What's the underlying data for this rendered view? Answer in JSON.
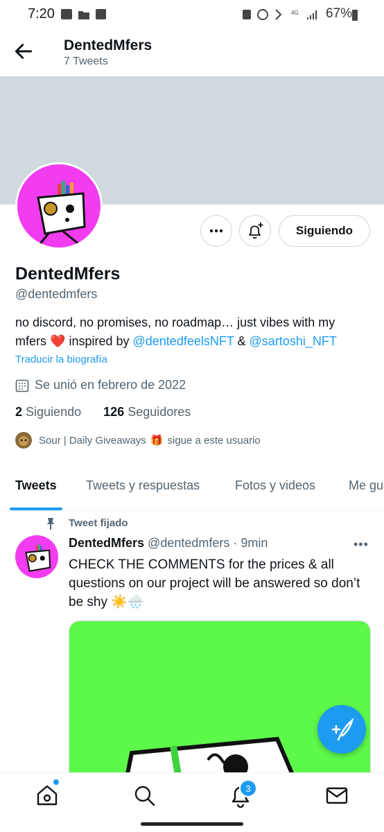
{
  "status_bar": {
    "time": "7:20",
    "battery": "67%"
  },
  "header": {
    "title": "DentedMfers",
    "subtitle": "7 Tweets"
  },
  "profile": {
    "name": "DentedMfers",
    "handle": "@dentedmfers",
    "follow_button": "Siguiendo",
    "bio_text_1": "no discord, no promises, no roadmap… just vibes with my mfers ",
    "bio_text_2": " inspired by ",
    "bio_link_1": "@dentedfeelsNFT",
    "bio_text_3": " & ",
    "bio_link_2": "@sartoshi_NFT",
    "translate": "Traducir la biografía",
    "joined": "Se unió en febrero de 2022",
    "following_count": "2",
    "following_label": "Siguiendo",
    "followers_count": "126",
    "followers_label": "Seguidores",
    "followed_by_text": "Sour | Daily Giveaways",
    "followed_by_suffix": "sigue a este usuario"
  },
  "tabs": [
    "Tweets",
    "Tweets y respuestas",
    "Fotos y videos",
    "Me gusta"
  ],
  "tweet": {
    "pinned_label": "Tweet fijado",
    "name": "DentedMfers",
    "handle": "@dentedmfers",
    "time": "· 9min",
    "text": "CHECK THE COMMENTS for the prices & all questions on our project will be answered so don’t be shy ☀️🌧️"
  },
  "bottom_nav": {
    "notifications_badge": "3"
  },
  "icons": [
    "back-arrow-icon",
    "more-icon",
    "bell-plus-icon",
    "calendar-icon",
    "gift-icon",
    "pin-icon",
    "compose-icon",
    "home-icon",
    "search-icon",
    "notifications-icon",
    "messages-icon"
  ],
  "colors": {
    "accent": "#1d9bf0",
    "avatar_bg": "#f23cf0",
    "media_bg": "#5cf94a",
    "banner": "#cfd9de"
  }
}
